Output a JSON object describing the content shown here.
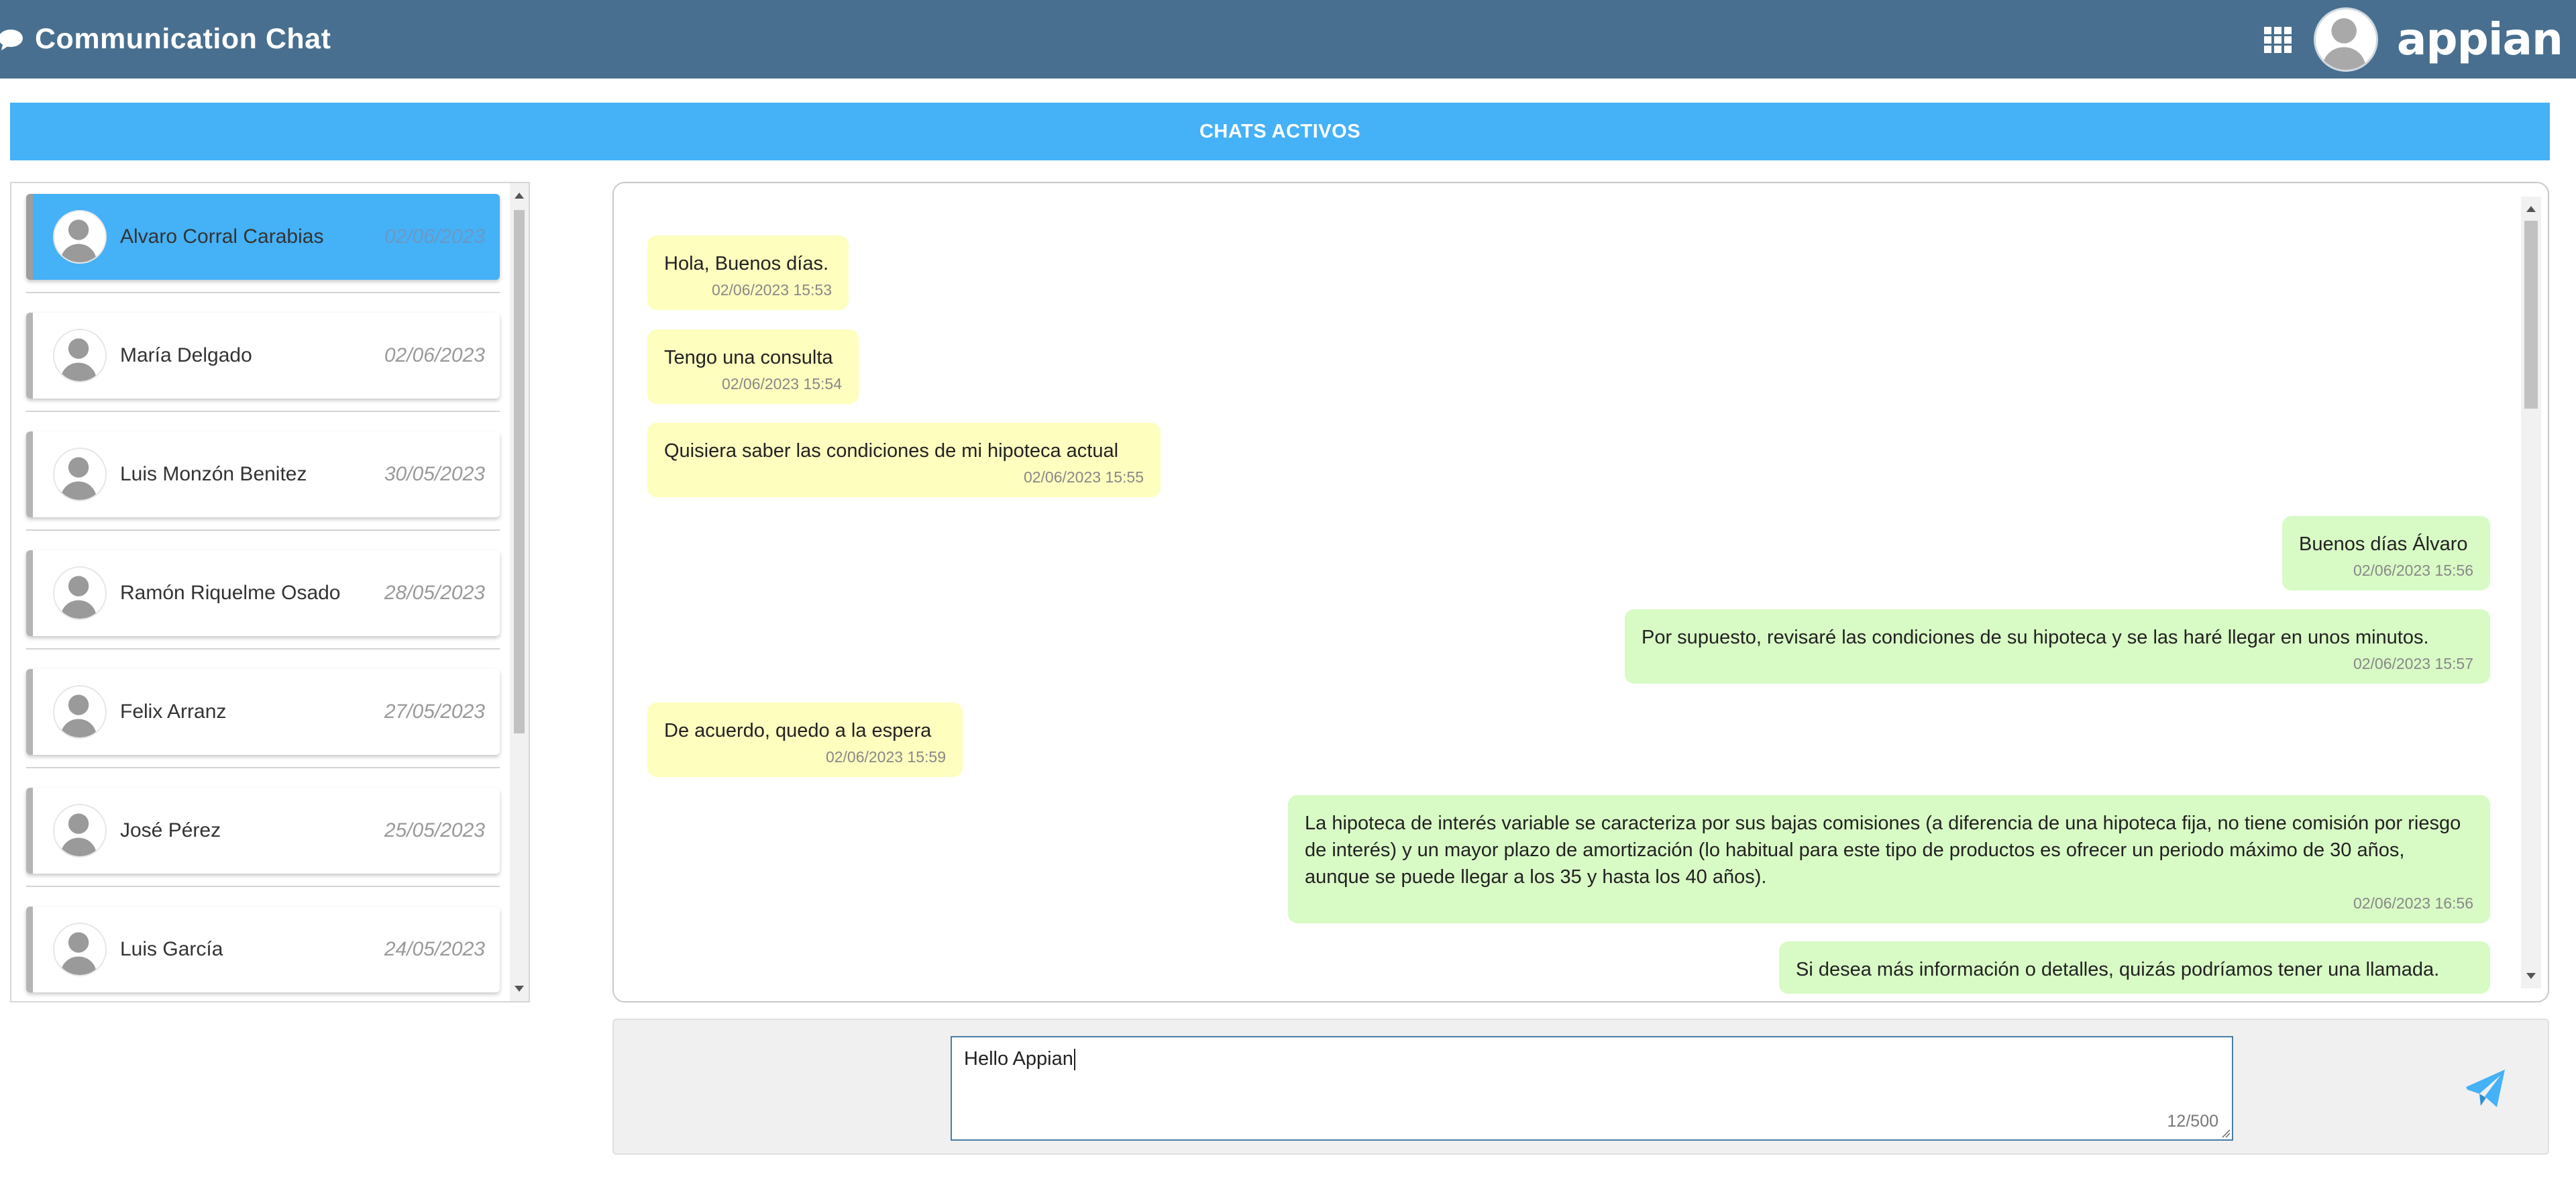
{
  "header": {
    "title": "Communication Chat",
    "logo": "appian",
    "icons": {
      "chat": "chat-bubble-icon",
      "apps": "app-grid-icon",
      "user": "user-avatar-icon"
    }
  },
  "banner": {
    "label": "CHATS ACTIVOS"
  },
  "contacts": [
    {
      "name": "Alvaro Corral Carabias",
      "date": "02/06/2023",
      "active": true
    },
    {
      "name": "María Delgado",
      "date": "02/06/2023",
      "active": false
    },
    {
      "name": "Luis Monzón Benitez",
      "date": "30/05/2023",
      "active": false
    },
    {
      "name": "Ramón Riquelme Osado",
      "date": "28/05/2023",
      "active": false
    },
    {
      "name": "Felix Arranz",
      "date": "27/05/2023",
      "active": false
    },
    {
      "name": "José Pérez",
      "date": "25/05/2023",
      "active": false
    },
    {
      "name": "Luis García",
      "date": "24/05/2023",
      "active": false
    }
  ],
  "messages": [
    {
      "direction": "in",
      "text": "Hola, Buenos días.",
      "time": "02/06/2023 15:53"
    },
    {
      "direction": "in",
      "text": "Tengo una consulta",
      "time": "02/06/2023 15:54"
    },
    {
      "direction": "in",
      "text": "Quisiera saber las condiciones de mi hipoteca actual",
      "time": "02/06/2023 15:55"
    },
    {
      "direction": "out",
      "text": "Buenos días Álvaro",
      "time": "02/06/2023 15:56"
    },
    {
      "direction": "out",
      "text": "Por supuesto, revisaré las condiciones de su hipoteca y se las haré llegar en unos minutos.",
      "time": "02/06/2023 15:57"
    },
    {
      "direction": "in",
      "text": "De acuerdo, quedo a la espera",
      "time": "02/06/2023 15:59"
    },
    {
      "direction": "out",
      "text": "La hipoteca de interés variable se caracteriza por sus bajas comisiones (a diferencia de una hipoteca fija, no tiene comisión por riesgo de interés) y un mayor plazo de amortización (lo habitual para este tipo de productos es ofrecer un periodo máximo de 30 años, aunque se puede llegar a los 35 y hasta los 40 años).",
      "time": "02/06/2023 16:56"
    },
    {
      "direction": "out",
      "text": "Si desea más información o detalles, quizás podríamos tener una llamada.",
      "time": ""
    }
  ],
  "composer": {
    "value": "Hello Appian",
    "counter": "12/500",
    "send_icon": "send-icon"
  },
  "colors": {
    "header_bg": "#486f8f",
    "banner_bg": "#45b1f7",
    "active_contact_bg": "#45b1f7",
    "incoming_bubble": "#fefebf",
    "outgoing_bubble": "#d8fac5"
  }
}
